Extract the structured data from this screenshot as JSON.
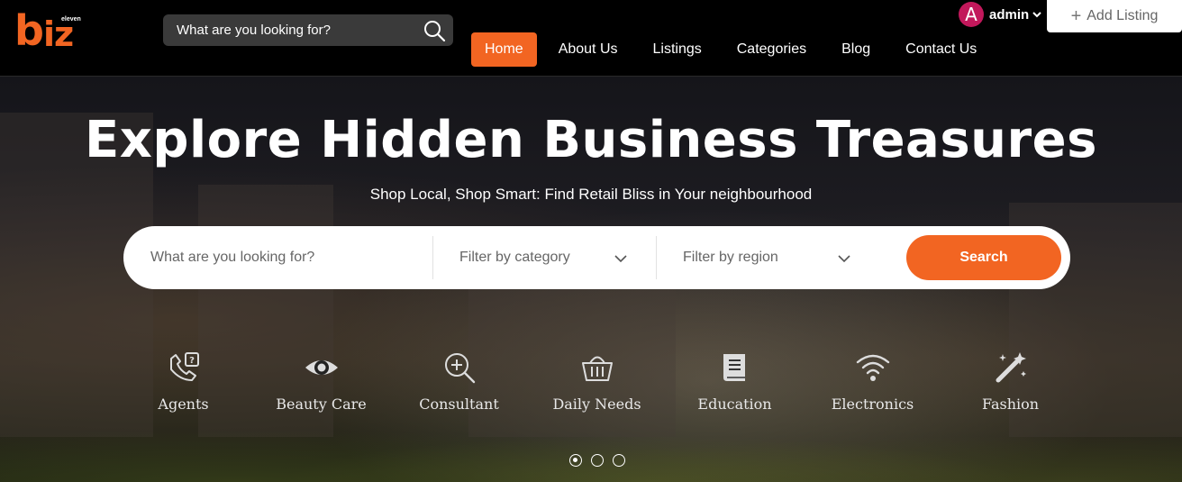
{
  "brand": {
    "logo_main": "biz",
    "logo_small": "eleven"
  },
  "header": {
    "search_placeholder": "What are you looking for?",
    "nav": [
      {
        "label": "Home",
        "active": true
      },
      {
        "label": "About Us",
        "active": false
      },
      {
        "label": "Listings",
        "active": false
      },
      {
        "label": "Categories",
        "active": false
      },
      {
        "label": "Blog",
        "active": false
      },
      {
        "label": "Contact Us",
        "active": false
      }
    ],
    "user": {
      "avatar_letter": "A",
      "name": "admin"
    },
    "add_listing": {
      "plus": "+",
      "label": "Add Listing"
    }
  },
  "hero": {
    "title": "Explore Hidden Business Treasures",
    "subtitle": "Shop Local, Shop Smart: Find Retail Bliss in Your neighbourhood",
    "search": {
      "placeholder": "What are you looking for?",
      "category_filter": "Filter by category",
      "region_filter": "Filter by region",
      "button": "Search"
    },
    "categories": [
      {
        "label": "Agents",
        "icon": "phone-question-icon"
      },
      {
        "label": "Beauty Care",
        "icon": "eye-icon"
      },
      {
        "label": "Consultant",
        "icon": "zoom-in-icon"
      },
      {
        "label": "Daily Needs",
        "icon": "basket-icon"
      },
      {
        "label": "Education",
        "icon": "book-icon"
      },
      {
        "label": "Electronics",
        "icon": "wifi-icon"
      },
      {
        "label": "Fashion",
        "icon": "magic-wand-icon"
      }
    ],
    "carousel": {
      "pages": 3,
      "active": 1
    }
  },
  "colors": {
    "accent": "#f26522",
    "avatar": "#c2185b"
  }
}
